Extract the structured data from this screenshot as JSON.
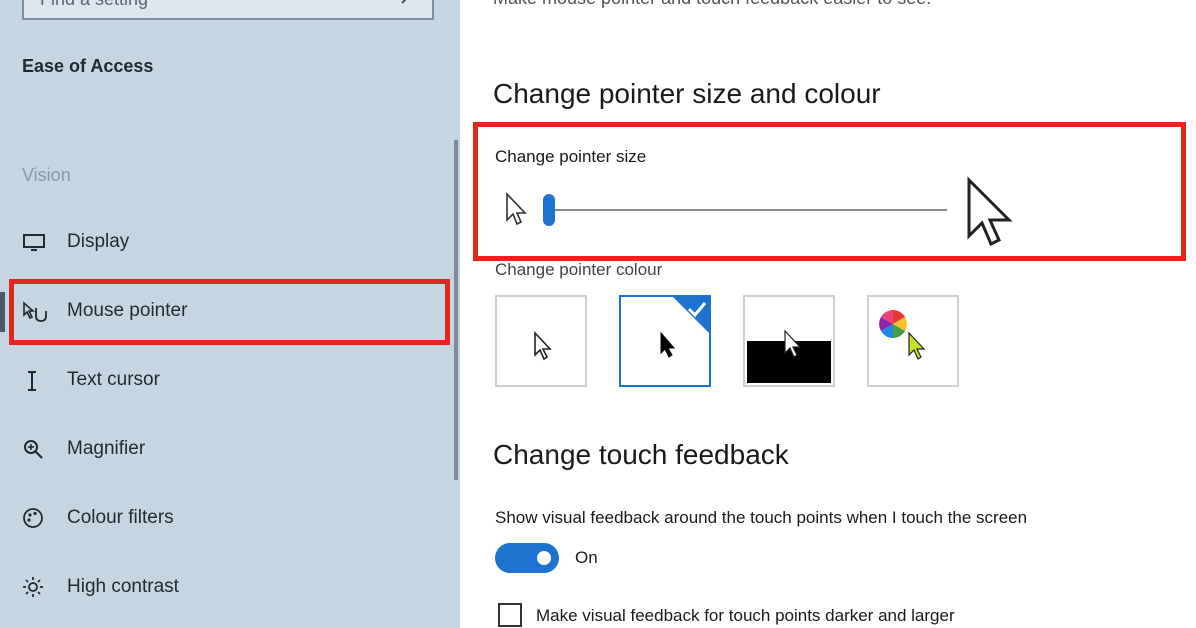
{
  "sidebar": {
    "search_placeholder": "Find a setting",
    "heading": "Ease of Access",
    "section_vision": "Vision",
    "items": [
      {
        "label": "Display",
        "icon": "display-icon"
      },
      {
        "label": "Mouse pointer",
        "icon": "mouse-pointer-icon"
      },
      {
        "label": "Text cursor",
        "icon": "text-cursor-icon"
      },
      {
        "label": "Magnifier",
        "icon": "magnifier-icon"
      },
      {
        "label": "Colour filters",
        "icon": "colour-filters-icon"
      },
      {
        "label": "High contrast",
        "icon": "high-contrast-icon"
      }
    ],
    "selected_item": "Mouse pointer"
  },
  "main": {
    "description": "Make mouse pointer and touch feedback easier to see.",
    "pointer_section_title": "Change pointer size and colour",
    "pointer_size_label": "Change pointer size",
    "pointer_size_level": 1,
    "pointer_colour_label": "Change pointer colour",
    "pointer_colour_options": [
      "white",
      "black",
      "inverted",
      "custom"
    ],
    "pointer_colour_selected": "black",
    "touch_section_title": "Change touch feedback",
    "touch_feedback_label": "Show visual feedback around the touch points when I touch the screen",
    "touch_feedback_state": "On",
    "darker_feedback_label": "Make visual feedback for touch points darker and larger",
    "darker_feedback_checked": false
  },
  "colors": {
    "accent": "#1e73d1",
    "highlight": "#e1261c",
    "sidebar_bg": "#c6d5e2"
  }
}
